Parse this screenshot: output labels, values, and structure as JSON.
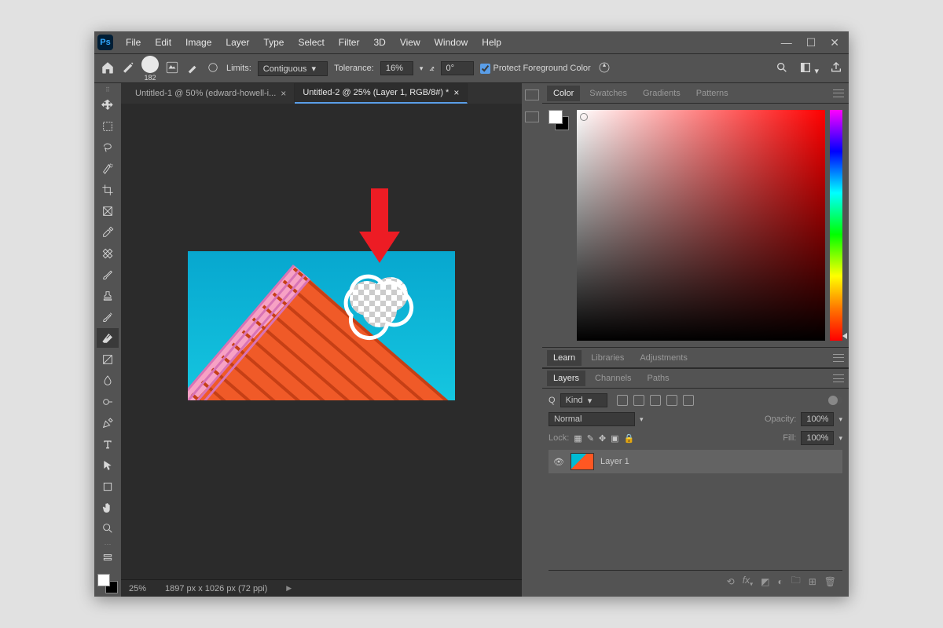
{
  "app": {
    "icon_text": "Ps"
  },
  "menu": [
    "File",
    "Edit",
    "Image",
    "Layer",
    "Type",
    "Select",
    "Filter",
    "3D",
    "View",
    "Window",
    "Help"
  ],
  "options": {
    "brush_size": "182",
    "limits_label": "Limits:",
    "limits_value": "Contiguous",
    "tolerance_label": "Tolerance:",
    "tolerance_value": "16%",
    "angle_value": "0°",
    "protect_label": "Protect Foreground Color"
  },
  "tabs": [
    {
      "label": "Untitled-1 @ 50% (edward-howell-i...",
      "active": false
    },
    {
      "label": "Untitled-2 @ 25% (Layer 1, RGB/8#) *",
      "active": true
    }
  ],
  "status": {
    "zoom": "25%",
    "dims": "1897 px x 1026 px (72 ppi)"
  },
  "panels": {
    "color_tabs": [
      "Color",
      "Swatches",
      "Gradients",
      "Patterns"
    ],
    "learn_tabs": [
      "Learn",
      "Libraries",
      "Adjustments"
    ],
    "layers_tabs": [
      "Layers",
      "Channels",
      "Paths"
    ]
  },
  "layers": {
    "filter_label": "Kind",
    "blend_mode": "Normal",
    "opacity_label": "Opacity:",
    "opacity_value": "100%",
    "lock_label": "Lock:",
    "fill_label": "Fill:",
    "fill_value": "100%",
    "items": [
      {
        "name": "Layer 1"
      }
    ]
  },
  "search_icon": "Q"
}
